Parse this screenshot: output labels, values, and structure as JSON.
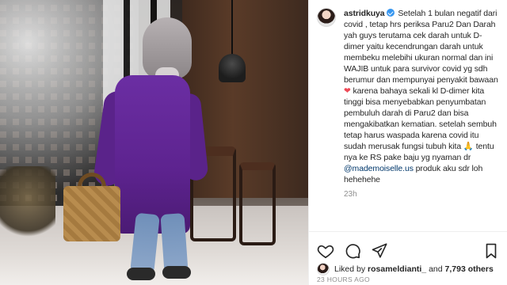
{
  "post": {
    "username": "astridkuya",
    "caption_1": "Setelah 1 bulan negatif dari covid , tetap hrs periksa Paru2 Dan Darah yah guys terutama cek darah untuk D-dimer yaitu kecendrungan darah untuk membeku melebihi ukuran normal dan ini WAJIB untuk para survivor covid yg sdh berumur dan mempunyai penyakit bawaan ",
    "heart_emoji": "❤",
    "caption_2": " karena bahaya sekali kl D-dimer kita tinggi bisa menyebabkan penyumbatan pembuluh darah di Paru2 dan bisa mengakibatkan kematian. setelah sembuh tetap harus waspada karena covid itu sudah merusak fungsi tubuh kita ",
    "praying_emoji": "🙏",
    "caption_3": " tentu nya ke RS pake baju yg nyaman dr ",
    "mention": "@mademoiselle.us",
    "caption_4": " produk aku sdr loh hehehehe",
    "time_since": "23h",
    "likes_prefix": "Liked by ",
    "likes_user": "rosameldianti_",
    "likes_and": " and ",
    "likes_others": "7,793 others",
    "posted_ago": "23 HOURS AGO"
  },
  "icons": {
    "verified": "verified-badge",
    "like": "heart-outline-icon",
    "comment": "comment-icon",
    "share": "share-icon",
    "save": "bookmark-icon"
  }
}
